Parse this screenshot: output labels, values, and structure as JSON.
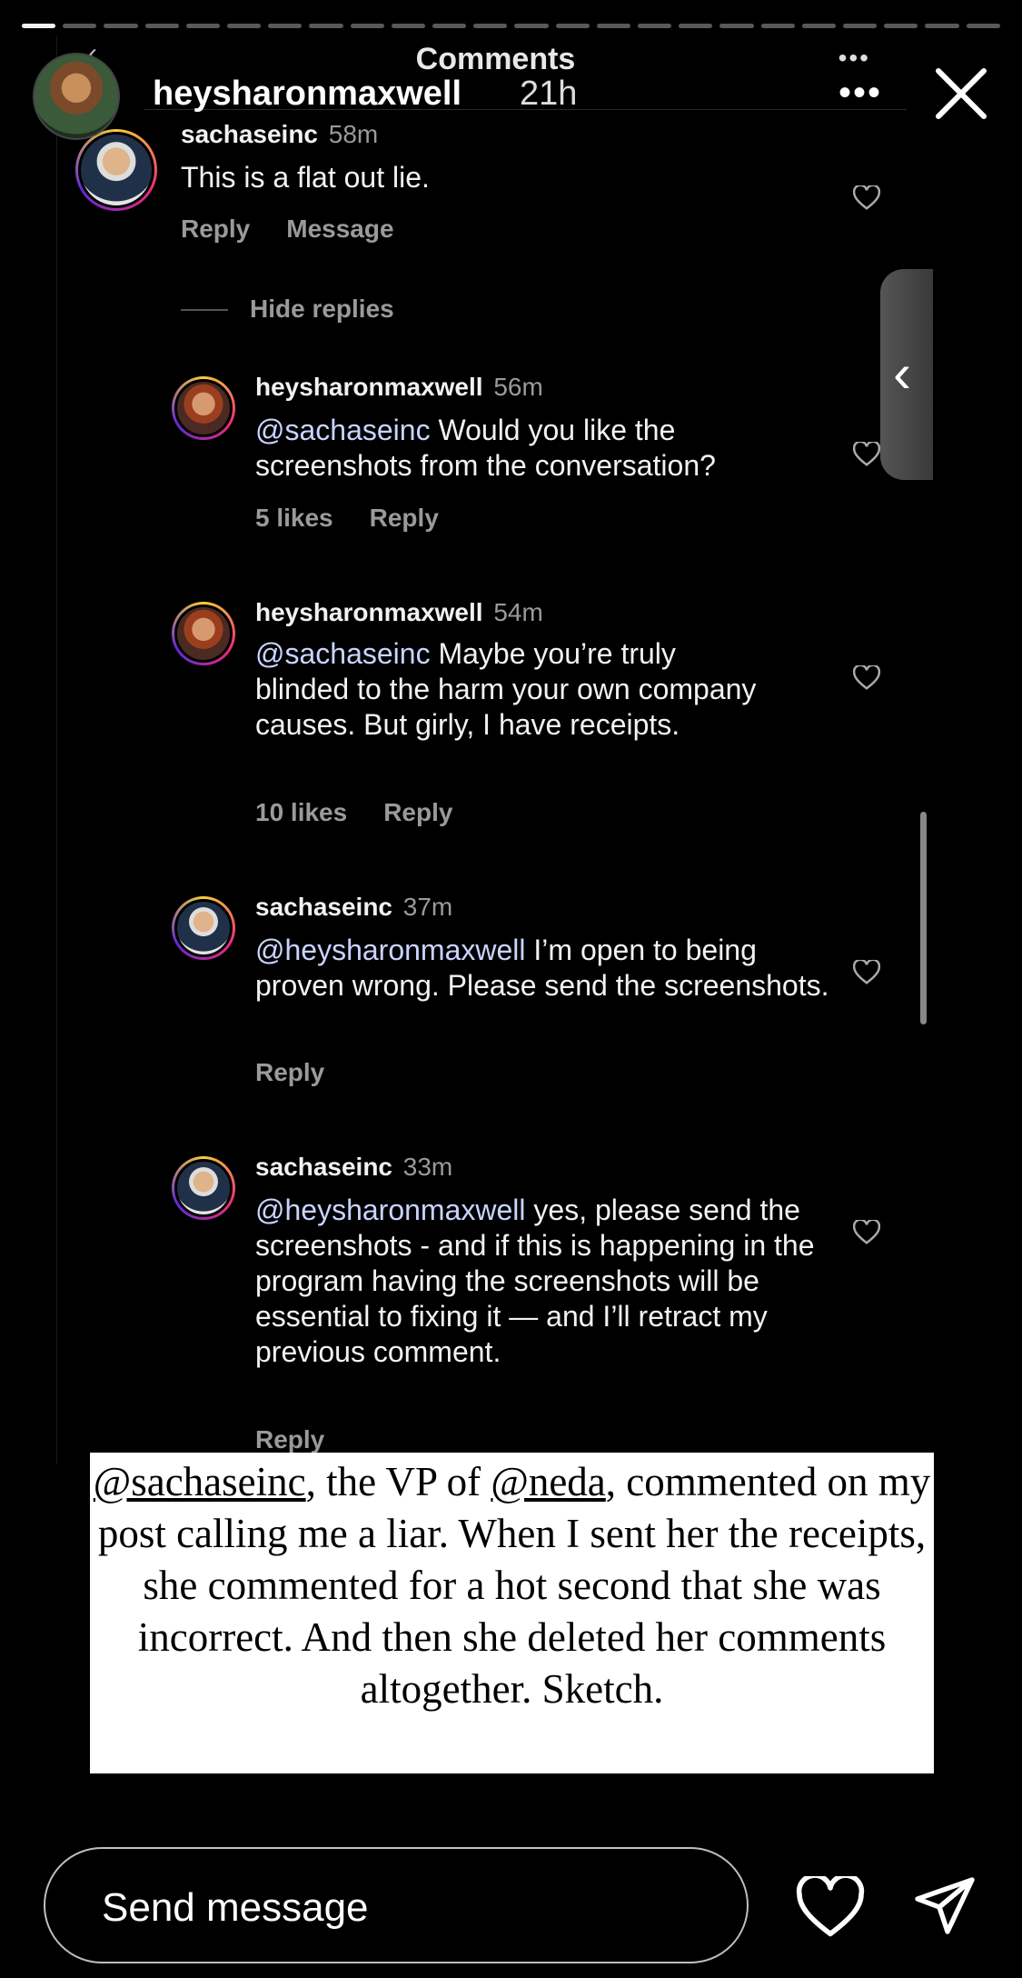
{
  "story": {
    "username": "heysharonmaxwell",
    "time": "21h",
    "more_icon": "more-icon",
    "close_icon": "close-icon"
  },
  "sheet": {
    "title": "Comments"
  },
  "comments": [
    {
      "user": "sachaseinc",
      "time": "58m",
      "mention": "",
      "text": "This is a flat out lie.",
      "actions": [
        "Reply",
        "Message"
      ]
    },
    {
      "user": "heysharonmaxwell",
      "time": "56m",
      "mention": "@sachaseinc",
      "text": " Would you like the screenshots from the conversation?",
      "actions": [
        "5 likes",
        "Reply"
      ]
    },
    {
      "user": "heysharonmaxwell",
      "time": "54m",
      "mention": "@sachaseinc",
      "text": " Maybe you’re truly blinded to the harm your own company causes. But girly, I have receipts.",
      "actions": [
        "10 likes",
        "Reply"
      ]
    },
    {
      "user": "sachaseinc",
      "time": "37m",
      "mention": "@heysharonmaxwell",
      "text": " I’m open to being proven wrong. Please send the screenshots.",
      "actions": [
        "Reply"
      ]
    },
    {
      "user": "sachaseinc",
      "time": "33m",
      "mention": "@heysharonmaxwell",
      "text": " yes, please send the screenshots - and if this is happening in the program having the screenshots will be essential to fixing it — and I’ll retract my previous comment.",
      "actions": [
        "Reply"
      ]
    }
  ],
  "hide_replies": "Hide replies",
  "caption": {
    "mention1": "@sachaseinc",
    "text1": ", the VP of ",
    "mention2": "@neda",
    "text2": ", commented on my post calling me a liar. When I sent her the receipts, she commented for a hot second that she was incorrect. And then she deleted her comments altogether. Sketch."
  },
  "footer": {
    "send_placeholder": "Send message",
    "like_icon": "heart-icon",
    "send_icon": "send-icon"
  }
}
